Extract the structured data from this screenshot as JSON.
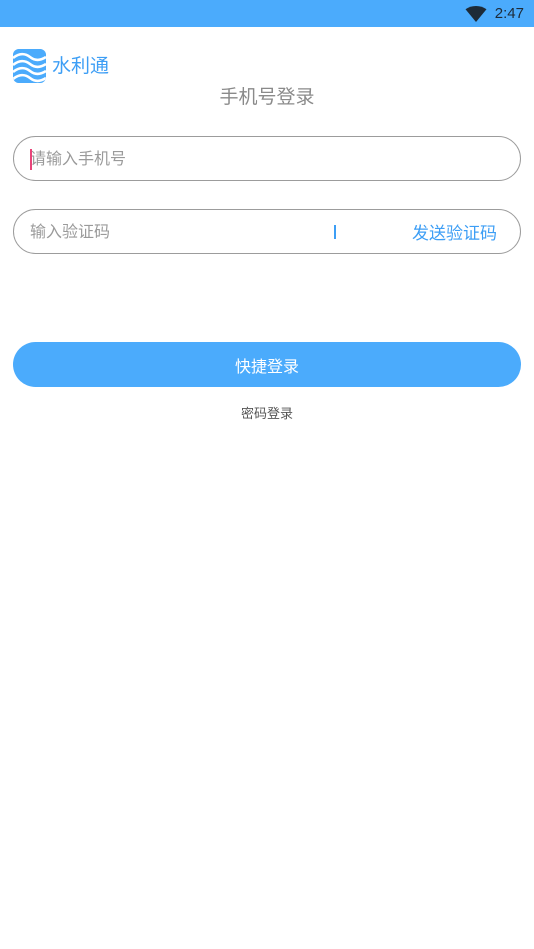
{
  "status_bar": {
    "time": "2:47",
    "wifi_icon": "wifi-icon",
    "background": "#4babfc"
  },
  "brand": {
    "app_name": "水利通",
    "logo_icon": "water-waves-icon"
  },
  "page": {
    "title": "手机号登录"
  },
  "phone_field": {
    "placeholder": "请输入手机号",
    "value": ""
  },
  "code_field": {
    "placeholder": "输入验证码",
    "value": "",
    "send_label": "发送验证码"
  },
  "actions": {
    "quick_login_label": "快捷登录",
    "password_login_label": "密码登录"
  },
  "colors": {
    "accent": "#4babfc",
    "link": "#3d9ef5",
    "cursor": "#e8457a"
  }
}
